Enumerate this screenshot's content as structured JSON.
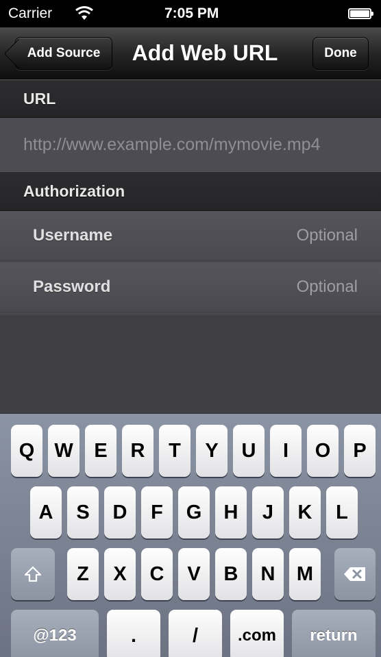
{
  "status_bar": {
    "carrier": "Carrier",
    "time": "7:05 PM",
    "wifi_icon": "wifi-icon",
    "battery_icon": "battery-icon"
  },
  "nav_bar": {
    "back_label": "Add Source",
    "title": "Add Web URL",
    "done_label": "Done"
  },
  "sections": {
    "url_header": "URL",
    "url_placeholder": "http://www.example.com/mymovie.mp4",
    "auth_header": "Authorization",
    "username_label": "Username",
    "username_placeholder": "Optional",
    "password_label": "Password",
    "password_placeholder": "Optional"
  },
  "keyboard": {
    "row1": [
      "Q",
      "W",
      "E",
      "R",
      "T",
      "Y",
      "U",
      "I",
      "O",
      "P"
    ],
    "row2": [
      "A",
      "S",
      "D",
      "F",
      "G",
      "H",
      "J",
      "K",
      "L"
    ],
    "row3": [
      "Z",
      "X",
      "C",
      "V",
      "B",
      "N",
      "M"
    ],
    "shift_icon": "shift-icon",
    "delete_icon": "backspace-icon",
    "num_label": "@123",
    "dot_label": ".",
    "slash_label": "/",
    "com_label": ".com",
    "return_label": "return"
  }
}
